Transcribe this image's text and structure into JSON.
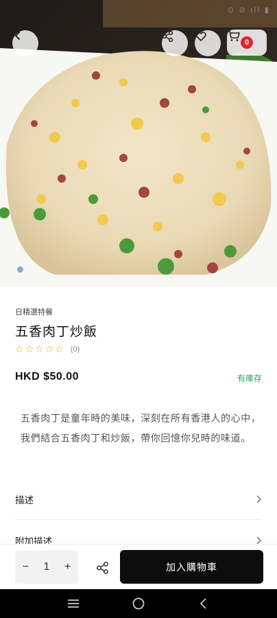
{
  "status_bar": {
    "icons_text": "⊙ ⊘ ıll ▮"
  },
  "header": {
    "cart_count": "0",
    "icons": [
      "back-arrow-icon",
      "share-icon",
      "heart-icon",
      "cart-icon"
    ]
  },
  "product": {
    "category": "日精選特餐",
    "name": "五香肉丁炒飯",
    "rating_stars": 0,
    "review_count": "(0)",
    "price": "HKD $50.00",
    "stock_status": "有庫存",
    "description": "五香肉丁是童年時的美味，深刻在所有香港人的心中，我們結合五香肉丁和炒飯，帶你回憶你兒時的味道。"
  },
  "sections": [
    {
      "label": "描述"
    },
    {
      "label": "附加描述"
    }
  ],
  "action_bar": {
    "quantity": "1",
    "minus": "−",
    "plus": "+",
    "add_to_cart": "加入購物車"
  },
  "colors": {
    "accent_stock": "#3aa35a",
    "badge": "#e0262e",
    "star": "#e8a82a",
    "primary_button": "#0d0d0d"
  }
}
